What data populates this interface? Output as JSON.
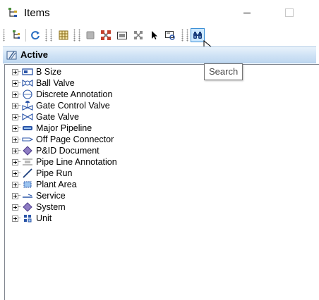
{
  "window": {
    "title": "Items",
    "title_icon": "item-tree-icon",
    "minimize_icon": "minimize-icon",
    "maximize_icon": "maximize-icon"
  },
  "toolbar": {
    "buttons": [
      {
        "icon": "tree-back-icon"
      },
      {
        "icon": "refresh-icon"
      },
      {
        "icon": "grid-view-icon"
      },
      {
        "icon": "gray-square-icon"
      },
      {
        "icon": "remove-items-icon"
      },
      {
        "icon": "image-frame-icon"
      },
      {
        "icon": "scatter-icon"
      },
      {
        "icon": "select-pointer-icon"
      },
      {
        "icon": "locate-icon"
      },
      {
        "icon": "binoculars-icon",
        "active": true
      }
    ]
  },
  "tooltip": {
    "text": "Search"
  },
  "active_bar": {
    "label": "Active",
    "icon": "filter-folder-icon"
  },
  "tree": {
    "items": [
      {
        "label": "B Size",
        "icon": "sheet-size-icon"
      },
      {
        "label": "Ball Valve",
        "icon": "ball-valve-icon"
      },
      {
        "label": "Discrete Annotation",
        "icon": "discrete-annotation-icon"
      },
      {
        "label": "Gate Control Valve",
        "icon": "gate-control-valve-icon"
      },
      {
        "label": "Gate Valve",
        "icon": "gate-valve-icon"
      },
      {
        "label": "Major Pipeline",
        "icon": "major-pipeline-icon"
      },
      {
        "label": "Off Page Connector",
        "icon": "off-page-connector-icon"
      },
      {
        "label": "P&ID Document",
        "icon": "pid-document-icon"
      },
      {
        "label": "Pipe Line Annotation",
        "icon": "pipe-line-annotation-icon"
      },
      {
        "label": "Pipe Run",
        "icon": "pipe-run-icon"
      },
      {
        "label": "Plant Area",
        "icon": "plant-area-icon"
      },
      {
        "label": "Service",
        "icon": "service-icon"
      },
      {
        "label": "System",
        "icon": "system-icon"
      },
      {
        "label": "Unit",
        "icon": "unit-icon"
      }
    ]
  },
  "colors": {
    "active_bar_start": "#e8f2fb",
    "active_bar_end": "#bfd8f0",
    "selected_button_bg": "#cce8ff",
    "selected_button_border": "#3c8fd6",
    "icon_blue": "#2b55a8"
  }
}
